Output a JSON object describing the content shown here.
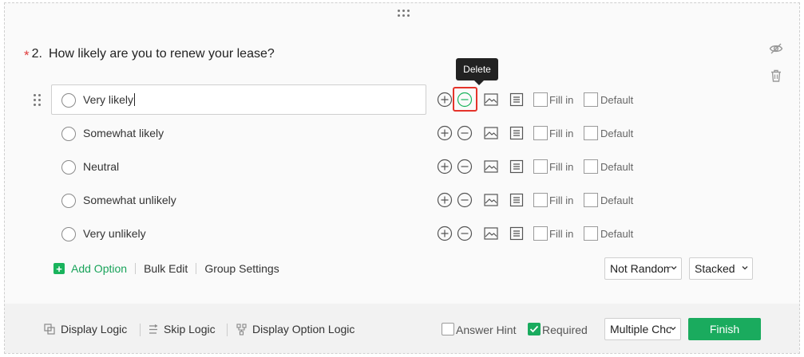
{
  "question": {
    "required_mark": "*",
    "number": "2.",
    "title": "How likely are you to renew your lease?"
  },
  "tooltip": {
    "text": "Delete"
  },
  "options": [
    {
      "label": "Very likely",
      "active": true
    },
    {
      "label": "Somewhat likely"
    },
    {
      "label": "Neutral"
    },
    {
      "label": "Somewhat unlikely"
    },
    {
      "label": "Very unlikely"
    }
  ],
  "option_controls": {
    "fill_in_label": "Fill in",
    "default_label": "Default",
    "icons": [
      "add-option-icon",
      "delete-option-icon",
      "image-icon",
      "description-icon"
    ]
  },
  "actions": {
    "add_option": "Add Option",
    "bulk_edit": "Bulk Edit",
    "group_settings": "Group Settings"
  },
  "selects": {
    "order": "Not Random",
    "layout": "Stacked",
    "question_type": "Multiple Choice"
  },
  "footer": {
    "display_logic": "Display Logic",
    "skip_logic": "Skip Logic",
    "display_option_logic": "Display Option Logic",
    "answer_hint": "Answer Hint",
    "answer_hint_checked": false,
    "required": "Required",
    "required_checked": true,
    "finish": "Finish"
  },
  "side_icons": [
    "hide-icon",
    "trash-icon"
  ],
  "colors": {
    "accent_green": "#19b35c",
    "required_red": "#e03b3b",
    "highlight_red": "#e5332a",
    "tooltip_bg": "#222222"
  }
}
